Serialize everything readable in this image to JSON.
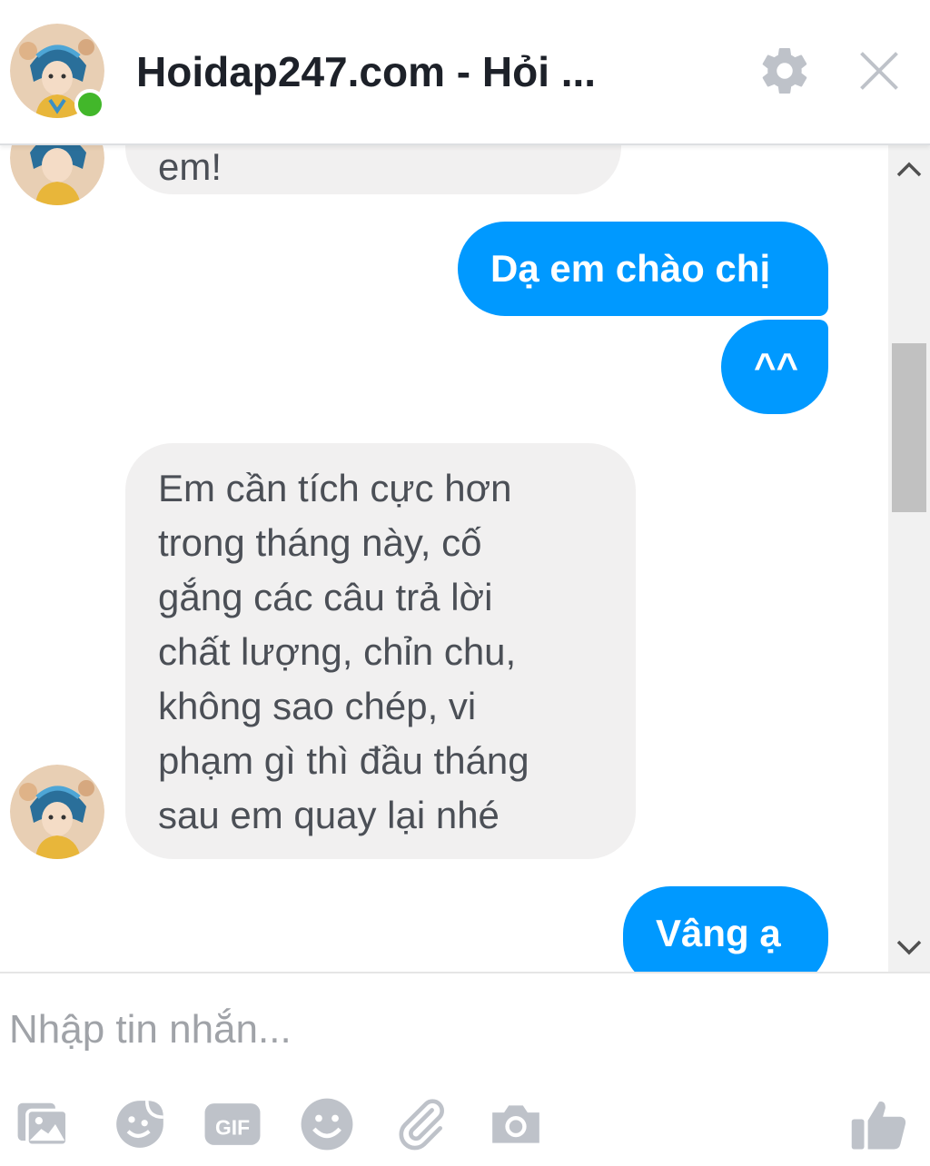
{
  "header": {
    "title": "Hoidap247.com - Hỏi ...",
    "settings_icon": "gear-icon",
    "close_icon": "close-icon",
    "online": true
  },
  "messages": [
    {
      "direction": "incoming",
      "lines": [
        "em!"
      ]
    },
    {
      "direction": "outgoing",
      "lines": [
        "Dạ em chào chị"
      ]
    },
    {
      "direction": "outgoing",
      "lines": [
        "^^"
      ]
    },
    {
      "direction": "incoming",
      "lines": [
        "Em cần tích cực hơn",
        "trong tháng này, cố",
        "gắng các câu trả lời",
        "chất lượng, chỉn chu,",
        "không sao chép, vi",
        "phạm gì thì đầu tháng",
        "sau em quay lại nhé"
      ]
    },
    {
      "direction": "outgoing",
      "lines": [
        "Vâng ạ"
      ]
    }
  ],
  "composer": {
    "placeholder": "Nhập tin nhắn...",
    "value": "",
    "tools": [
      "photo-icon",
      "sticker-icon",
      "gif-icon",
      "emoji-icon",
      "attachment-icon",
      "camera-icon"
    ],
    "send_icon": "thumbs-up-icon"
  },
  "colors": {
    "outgoing_bubble": "#0099ff",
    "incoming_bubble": "#f1f0f0",
    "online_dot": "#42b72a",
    "icon_gray": "#bec2c9"
  }
}
